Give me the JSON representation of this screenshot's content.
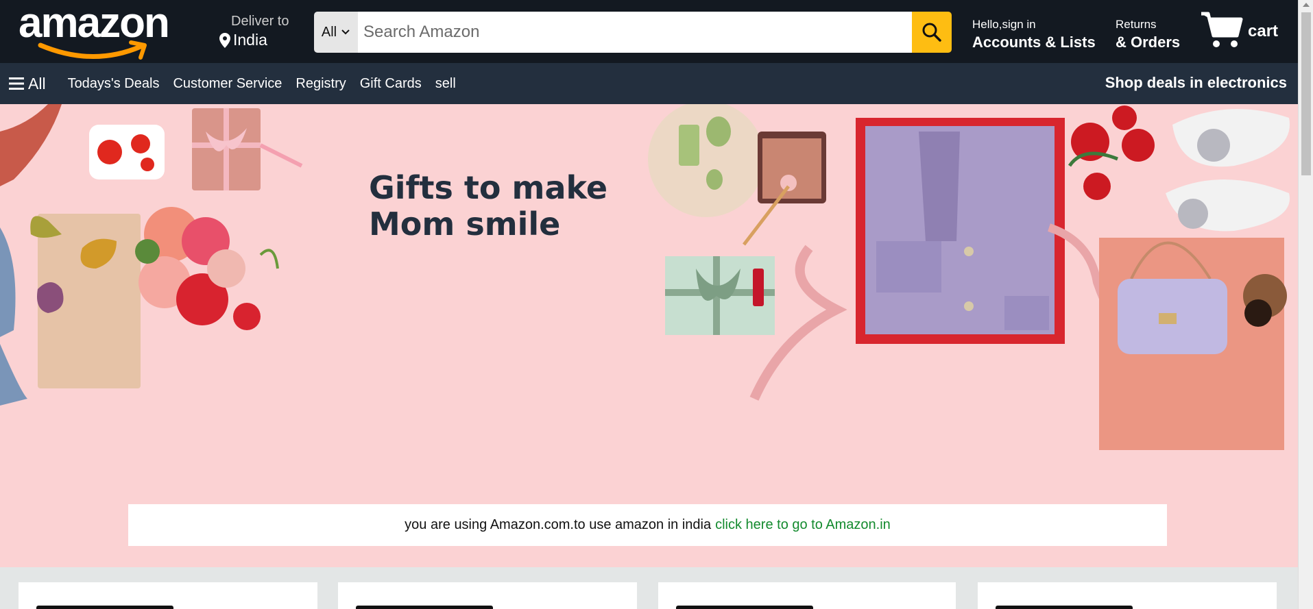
{
  "header": {
    "logo_text": "amazon",
    "deliver_label": "Deliver to",
    "deliver_location": "India",
    "search_category": "All",
    "search_placeholder": "Search Amazon",
    "account_greeting": "Hello,sign in",
    "account_label": "Accounts & Lists",
    "returns_label": "Returns",
    "orders_label": "& Orders",
    "cart_label": "cart"
  },
  "subnav": {
    "all_label": "All",
    "links": [
      "Todays's Deals",
      "Customer Service",
      "Registry",
      "Gift Cards",
      "sell"
    ],
    "promo": "Shop deals in electronics"
  },
  "hero": {
    "title_line1": "Gifts to make",
    "title_line2": "Mom smile"
  },
  "banner": {
    "text": "you are using Amazon.com.to use amazon in india",
    "link": "click here to go to Amazon.in"
  },
  "colors": {
    "nav_bg": "#131921",
    "subnav_bg": "#232f3e",
    "search_button": "#febd12",
    "hero_bg": "#fbd2d3",
    "link_green": "#138a2e",
    "logo_arrow": "#ff9900"
  }
}
